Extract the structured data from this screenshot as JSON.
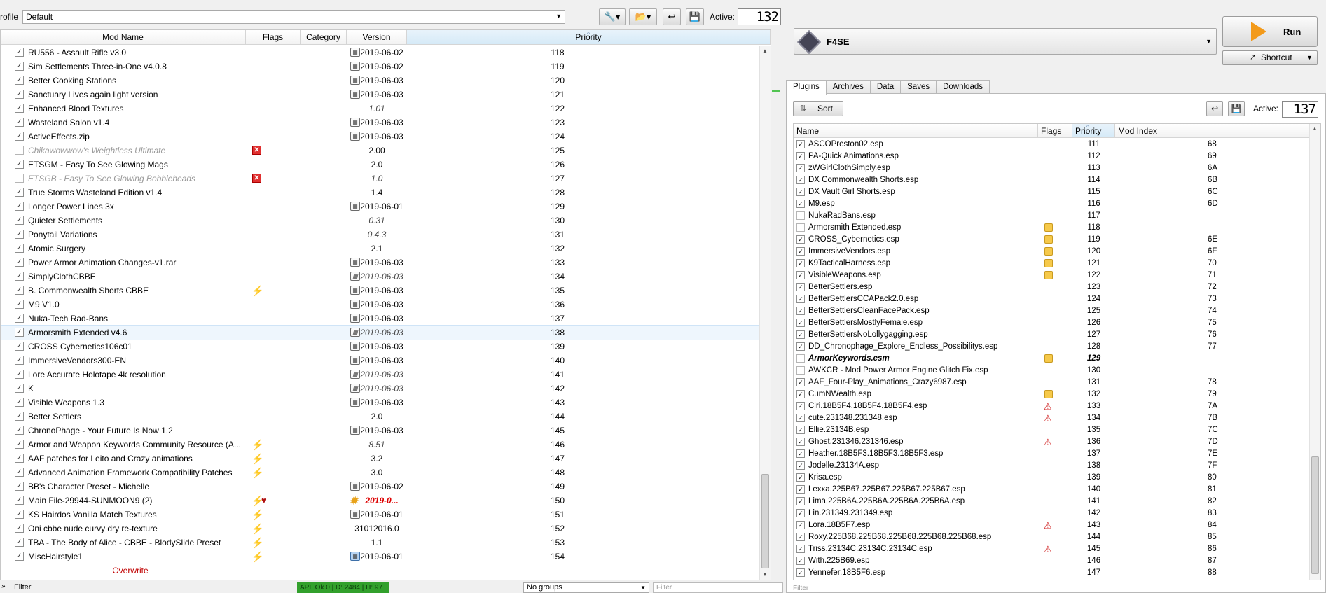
{
  "profile": {
    "label": "Profile",
    "value": "Default"
  },
  "toolbar": {
    "active_label": "Active:",
    "active_count": "132"
  },
  "mod_table": {
    "columns": [
      "Mod Name",
      "Flags",
      "Category",
      "Version",
      "Priority"
    ],
    "rows": [
      {
        "name": "RU556 - Assault Rifle v3.0",
        "checked": true,
        "flag": "",
        "vicon": "cal",
        "version": "2019-06-02",
        "vstyle": "",
        "priority": "118"
      },
      {
        "name": "Sim Settlements Three-in-One v4.0.8",
        "checked": true,
        "flag": "",
        "vicon": "cal",
        "version": "2019-06-02",
        "vstyle": "",
        "priority": "119"
      },
      {
        "name": "Better Cooking Stations",
        "checked": true,
        "flag": "",
        "vicon": "cal",
        "version": "2019-06-03",
        "vstyle": "",
        "priority": "120"
      },
      {
        "name": "Sanctuary Lives again light version",
        "checked": true,
        "flag": "",
        "vicon": "cal",
        "version": "2019-06-03",
        "vstyle": "",
        "priority": "121"
      },
      {
        "name": "Enhanced Blood Textures",
        "checked": true,
        "flag": "",
        "vicon": "",
        "version": "1.01",
        "vstyle": "italic",
        "priority": "122"
      },
      {
        "name": "Wasteland Salon v1.4",
        "checked": true,
        "flag": "",
        "vicon": "cal",
        "version": "2019-06-03",
        "vstyle": "",
        "priority": "123"
      },
      {
        "name": "ActiveEffects.zip",
        "checked": true,
        "flag": "",
        "vicon": "cal",
        "version": "2019-06-03",
        "vstyle": "",
        "priority": "124"
      },
      {
        "name": "Chikawowwow's Weightless Ultimate",
        "checked": false,
        "flag": "x",
        "vicon": "",
        "version": "2.00",
        "vstyle": "",
        "priority": "125"
      },
      {
        "name": "ETSGM - Easy To See Glowing Mags",
        "checked": true,
        "flag": "",
        "vicon": "",
        "version": "2.0",
        "vstyle": "",
        "priority": "126"
      },
      {
        "name": "ETSGB - Easy To See Glowing Bobbleheads",
        "checked": false,
        "flag": "x",
        "vicon": "",
        "version": "1.0",
        "vstyle": "italic",
        "priority": "127"
      },
      {
        "name": "True Storms Wasteland Edition v1.4",
        "checked": true,
        "flag": "",
        "vicon": "",
        "version": "1.4",
        "vstyle": "",
        "priority": "128"
      },
      {
        "name": "Longer Power Lines 3x",
        "checked": true,
        "flag": "",
        "vicon": "cal",
        "version": "2019-06-01",
        "vstyle": "",
        "priority": "129"
      },
      {
        "name": "Quieter Settlements",
        "checked": true,
        "flag": "",
        "vicon": "",
        "version": "0.31",
        "vstyle": "italic",
        "priority": "130"
      },
      {
        "name": "Ponytail Variations",
        "checked": true,
        "flag": "",
        "vicon": "",
        "version": "0.4.3",
        "vstyle": "italic",
        "priority": "131"
      },
      {
        "name": "Atomic Surgery",
        "checked": true,
        "flag": "",
        "vicon": "",
        "version": "2.1",
        "vstyle": "",
        "priority": "132"
      },
      {
        "name": "Power Armor Animation Changes-v1.rar",
        "checked": true,
        "flag": "",
        "vicon": "cal",
        "version": "2019-06-03",
        "vstyle": "",
        "priority": "133"
      },
      {
        "name": "SimplyClothCBBE",
        "checked": true,
        "flag": "",
        "vicon": "cal",
        "version": "2019-06-03",
        "vstyle": "italic",
        "priority": "134"
      },
      {
        "name": "B. Commonwealth Shorts CBBE",
        "checked": true,
        "flag": "bolt",
        "vicon": "cal",
        "version": "2019-06-03",
        "vstyle": "",
        "priority": "135"
      },
      {
        "name": "M9 V1.0",
        "checked": true,
        "flag": "",
        "vicon": "cal",
        "version": "2019-06-03",
        "vstyle": "",
        "priority": "136"
      },
      {
        "name": "Nuka-Tech Rad-Bans",
        "checked": true,
        "flag": "",
        "vicon": "cal",
        "version": "2019-06-03",
        "vstyle": "",
        "priority": "137"
      },
      {
        "name": "Armorsmith Extended v4.6",
        "checked": true,
        "flag": "",
        "vicon": "cal",
        "version": "2019-06-03",
        "vstyle": "italic",
        "priority": "138",
        "selected": true
      },
      {
        "name": "CROSS Cybernetics106c01",
        "checked": true,
        "flag": "",
        "vicon": "cal",
        "version": "2019-06-03",
        "vstyle": "",
        "priority": "139"
      },
      {
        "name": "ImmersiveVendors300-EN",
        "checked": true,
        "flag": "",
        "vicon": "cal",
        "version": "2019-06-03",
        "vstyle": "",
        "priority": "140"
      },
      {
        "name": "Lore Accurate Holotape 4k resolution",
        "checked": true,
        "flag": "",
        "vicon": "cal",
        "version": "2019-06-03",
        "vstyle": "italic",
        "priority": "141"
      },
      {
        "name": "K",
        "checked": true,
        "flag": "",
        "vicon": "cal",
        "version": "2019-06-03",
        "vstyle": "italic",
        "priority": "142"
      },
      {
        "name": "Visible Weapons 1.3",
        "checked": true,
        "flag": "",
        "vicon": "cal",
        "version": "2019-06-03",
        "vstyle": "",
        "priority": "143"
      },
      {
        "name": "Better Settlers",
        "checked": true,
        "flag": "",
        "vicon": "",
        "version": "2.0",
        "vstyle": "",
        "priority": "144"
      },
      {
        "name": "ChronoPhage - Your Future Is Now 1.2",
        "checked": true,
        "flag": "",
        "vicon": "cal",
        "version": "2019-06-03",
        "vstyle": "",
        "priority": "145"
      },
      {
        "name": "Armor and Weapon Keywords Community Resource (A...",
        "checked": true,
        "flag": "bolt",
        "vicon": "",
        "version": "8.51",
        "vstyle": "italic",
        "priority": "146"
      },
      {
        "name": "AAF patches for Leito and Crazy animations",
        "checked": true,
        "flag": "bolt",
        "vicon": "",
        "version": "3.2",
        "vstyle": "",
        "priority": "147"
      },
      {
        "name": "Advanced Animation Framework Compatibility Patches",
        "checked": true,
        "flag": "bolt",
        "vicon": "",
        "version": "3.0",
        "vstyle": "",
        "priority": "148"
      },
      {
        "name": "BB's Character Preset - Michelle",
        "checked": true,
        "flag": "",
        "vicon": "cal",
        "version": "2019-06-02",
        "vstyle": "",
        "priority": "149"
      },
      {
        "name": "Main File-29944-SUNMOON9 (2)",
        "checked": true,
        "flag": "bolt-heart",
        "vicon": "star",
        "version": "2019-0...",
        "vstyle": "red",
        "priority": "150"
      },
      {
        "name": "KS Hairdos Vanilla Match Textures",
        "checked": true,
        "flag": "bolt",
        "vicon": "cal",
        "version": "2019-06-01",
        "vstyle": "",
        "priority": "151"
      },
      {
        "name": "Oni cbbe nude curvy dry re-texture",
        "checked": true,
        "flag": "bolt",
        "vicon": "",
        "version": "31012016.0",
        "vstyle": "",
        "priority": "152"
      },
      {
        "name": "TBA - The Body of Alice - CBBE - BlodySlide Preset",
        "checked": true,
        "flag": "bolt",
        "vicon": "",
        "version": "1.1",
        "vstyle": "",
        "priority": "153"
      },
      {
        "name": "MiscHairstyle1",
        "checked": true,
        "flag": "bolt",
        "vicon": "calblue",
        "version": "2019-06-01",
        "vstyle": "",
        "priority": "154"
      }
    ],
    "overwrite_label": "Overwrite"
  },
  "bottom": {
    "filter_label": "Filter",
    "api_badge": "API: Ok 0 | D: 2484 | H: 97",
    "groups": "No groups",
    "filter_placeholder": "Filter"
  },
  "executable": {
    "name": "F4SE"
  },
  "run": {
    "label": "Run"
  },
  "shortcut": {
    "label": "Shortcut"
  },
  "tabs": [
    "Plugins",
    "Archives",
    "Data",
    "Saves",
    "Downloads"
  ],
  "plugins": {
    "sort_label": "Sort",
    "active_label": "Active:",
    "active_count": "137",
    "columns": [
      "Name",
      "Flags",
      "Priority",
      "Mod Index"
    ],
    "rows": [
      {
        "name": "ASCOPreston02.esp",
        "checked": true,
        "flag": "",
        "priority": "111",
        "index": "68"
      },
      {
        "name": "PA-Quick Animations.esp",
        "checked": true,
        "flag": "",
        "priority": "112",
        "index": "69"
      },
      {
        "name": "zWGirlClothSimply.esp",
        "checked": true,
        "flag": "",
        "priority": "113",
        "index": "6A"
      },
      {
        "name": "DX Commonwealth Shorts.esp",
        "checked": true,
        "flag": "",
        "priority": "114",
        "index": "6B"
      },
      {
        "name": "DX Vault Girl Shorts.esp",
        "checked": true,
        "flag": "",
        "priority": "115",
        "index": "6C"
      },
      {
        "name": "M9.esp",
        "checked": true,
        "flag": "",
        "priority": "116",
        "index": "6D"
      },
      {
        "name": "NukaRadBans.esp",
        "checked": false,
        "flag": "",
        "priority": "117",
        "index": ""
      },
      {
        "name": "Armorsmith Extended.esp",
        "checked": false,
        "flag": "cube",
        "priority": "118",
        "index": ""
      },
      {
        "name": "CROSS_Cybernetics.esp",
        "checked": true,
        "flag": "cube",
        "priority": "119",
        "index": "6E"
      },
      {
        "name": "ImmersiveVendors.esp",
        "checked": true,
        "flag": "cube",
        "priority": "120",
        "index": "6F"
      },
      {
        "name": "K9TacticalHarness.esp",
        "checked": true,
        "flag": "cube",
        "priority": "121",
        "index": "70"
      },
      {
        "name": "VisibleWeapons.esp",
        "checked": true,
        "flag": "cube",
        "priority": "122",
        "index": "71"
      },
      {
        "name": "BetterSettlers.esp",
        "checked": true,
        "flag": "",
        "priority": "123",
        "index": "72"
      },
      {
        "name": "BetterSettlersCCAPack2.0.esp",
        "checked": true,
        "flag": "",
        "priority": "124",
        "index": "73"
      },
      {
        "name": "BetterSettlersCleanFacePack.esp",
        "checked": true,
        "flag": "",
        "priority": "125",
        "index": "74"
      },
      {
        "name": "BetterSettlersMostlyFemale.esp",
        "checked": true,
        "flag": "",
        "priority": "126",
        "index": "75"
      },
      {
        "name": "BetterSettlersNoLollygagging.esp",
        "checked": true,
        "flag": "",
        "priority": "127",
        "index": "76"
      },
      {
        "name": "DD_Chronophage_Explore_Endless_Possibilitys.esp",
        "checked": true,
        "flag": "",
        "priority": "128",
        "index": "77"
      },
      {
        "name": "ArmorKeywords.esm",
        "checked": false,
        "flag": "cube",
        "priority": "129",
        "index": "",
        "bold": true
      },
      {
        "name": "AWKCR - Mod Power Armor Engine Glitch Fix.esp",
        "checked": false,
        "flag": "",
        "priority": "130",
        "index": ""
      },
      {
        "name": "AAF_Four-Play_Animations_Crazy6987.esp",
        "checked": true,
        "flag": "",
        "priority": "131",
        "index": "78"
      },
      {
        "name": "CumNWealth.esp",
        "checked": true,
        "flag": "cube",
        "priority": "132",
        "index": "79"
      },
      {
        "name": "Ciri.18B5F4.18B5F4.18B5F4.esp",
        "checked": true,
        "flag": "warn",
        "priority": "133",
        "index": "7A"
      },
      {
        "name": "cute.231348.231348.esp",
        "checked": true,
        "flag": "warn",
        "priority": "134",
        "index": "7B"
      },
      {
        "name": "Ellie.23134B.esp",
        "checked": true,
        "flag": "",
        "priority": "135",
        "index": "7C"
      },
      {
        "name": "Ghost.231346.231346.esp",
        "checked": true,
        "flag": "warn",
        "priority": "136",
        "index": "7D"
      },
      {
        "name": "Heather.18B5F3.18B5F3.18B5F3.esp",
        "checked": true,
        "flag": "",
        "priority": "137",
        "index": "7E"
      },
      {
        "name": "Jodelle.23134A.esp",
        "checked": true,
        "flag": "",
        "priority": "138",
        "index": "7F"
      },
      {
        "name": "Krisa.esp",
        "checked": true,
        "flag": "",
        "priority": "139",
        "index": "80"
      },
      {
        "name": "Lexxa.225B67.225B67.225B67.225B67.esp",
        "checked": true,
        "flag": "",
        "priority": "140",
        "index": "81"
      },
      {
        "name": "Lima.225B6A.225B6A.225B6A.225B6A.esp",
        "checked": true,
        "flag": "",
        "priority": "141",
        "index": "82"
      },
      {
        "name": "Lin.231349.231349.esp",
        "checked": true,
        "flag": "",
        "priority": "142",
        "index": "83"
      },
      {
        "name": "Lora.18B5F7.esp",
        "checked": true,
        "flag": "warn",
        "priority": "143",
        "index": "84"
      },
      {
        "name": "Roxy.225B68.225B68.225B68.225B68.225B68.esp",
        "checked": true,
        "flag": "",
        "priority": "144",
        "index": "85"
      },
      {
        "name": "Triss.23134C.23134C.23134C.esp",
        "checked": true,
        "flag": "warn",
        "priority": "145",
        "index": "86"
      },
      {
        "name": "With.225B69.esp",
        "checked": true,
        "flag": "",
        "priority": "146",
        "index": "87"
      },
      {
        "name": "Yennefer.18B5F6.esp",
        "checked": true,
        "flag": "",
        "priority": "147",
        "index": "88"
      }
    ],
    "filter_placeholder": "Filter"
  },
  "colors": {
    "selection": "#eef6fd",
    "api_green": "#32a02c",
    "run_orange": "#f39a1a",
    "warn_red": "#d02020"
  }
}
